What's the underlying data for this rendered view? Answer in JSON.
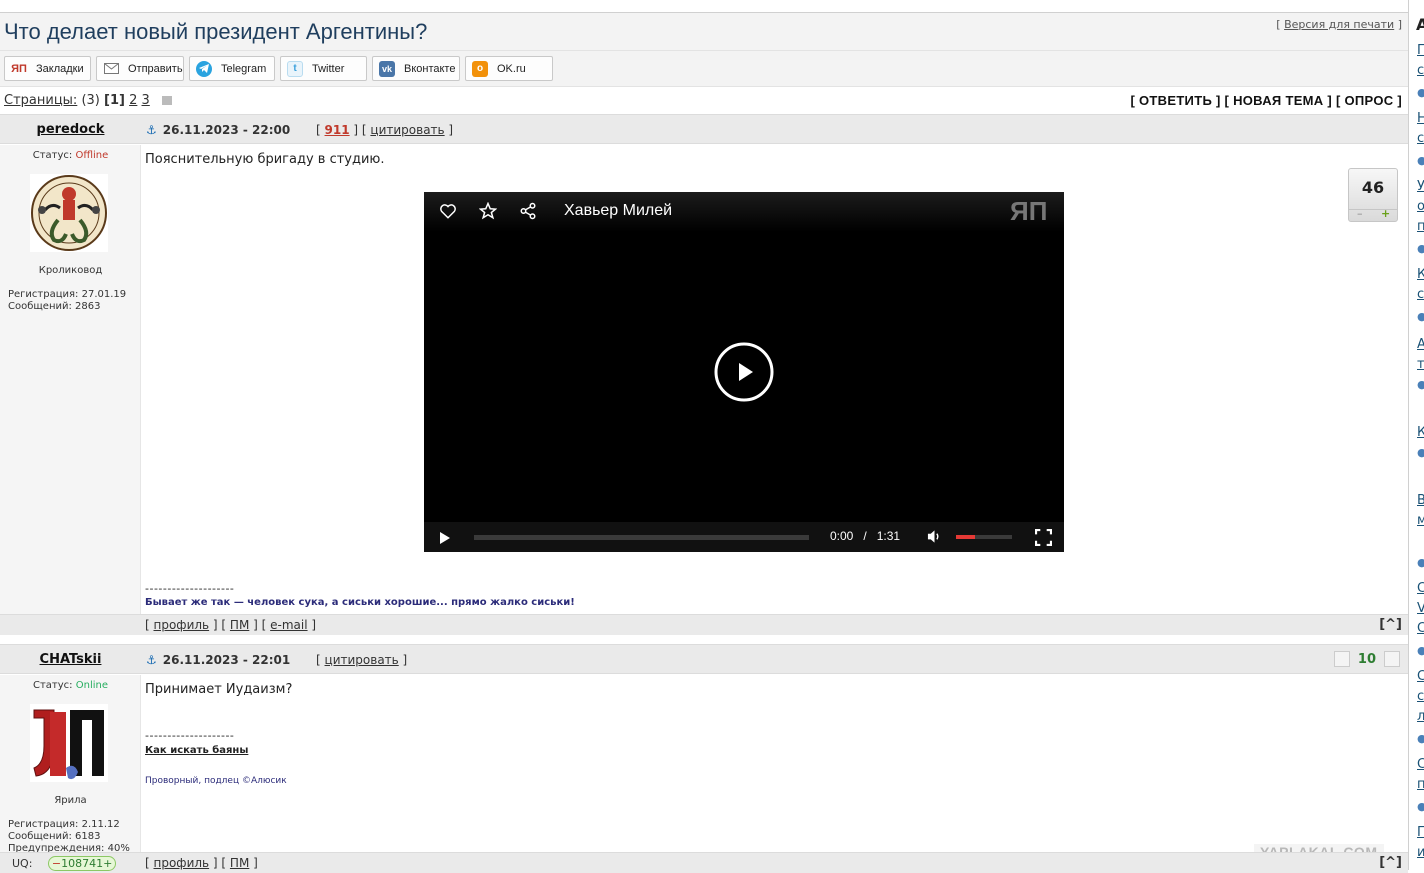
{
  "topic": {
    "title": "Что делает новый президент Аргентины?",
    "print_version": "Версия для печати"
  },
  "share_buttons": [
    {
      "label": "Закладки",
      "icon": "yp-bookmark-icon"
    },
    {
      "label": "Отправить",
      "icon": "mail-icon"
    },
    {
      "label": "Telegram",
      "icon": "telegram-icon"
    },
    {
      "label": "Twitter",
      "icon": "twitter-icon"
    },
    {
      "label": "Вконтакте",
      "icon": "vk-icon"
    },
    {
      "label": "OK.ru",
      "icon": "odnoklassniki-icon"
    }
  ],
  "pages": {
    "label": "Страницы:",
    "count": "(3)",
    "current": "[1]",
    "others": [
      "2",
      "3"
    ],
    "actions": "[ ОТВЕТИТЬ ] [ НОВАЯ ТЕМА ] [ ОПРОС ]"
  },
  "posts": [
    {
      "author": "peredock",
      "status_label": "Статус:",
      "status": "Offline",
      "rank": "Кроликовод",
      "registration": "Регистрация: 27.01.19",
      "messages": "Сообщений: 2863",
      "date": "26.11.2023 - 22:00",
      "post_number": "911",
      "quote": "цитировать",
      "text": "Пояснительную бригаду в студию.",
      "signature_sep": "--------------------",
      "signature": "Бывает же так — человек сука, а сиськи хорошие... прямо жалко сиськи!",
      "rating": "46",
      "video": {
        "title": "Хавьер Милей",
        "time_current": "0:00",
        "time_sep": "/",
        "time_total": "1:31",
        "logo": "ЯП"
      },
      "footer": [
        "профиль",
        "ПМ",
        "e-mail"
      ],
      "top_link": "[^]"
    },
    {
      "author": "CHATskii",
      "status_label": "Статус:",
      "status": "Online",
      "rank": "Ярила",
      "registration": "Регистрация: 2.11.12",
      "messages": "Сообщений: 6183",
      "warnings_label": "Предупреждения:",
      "warnings_value": "40",
      "date": "26.11.2023 - 22:01",
      "quote": "цитировать",
      "text": "Принимает Иудаизм?",
      "signature_sep": "--------------------",
      "signature_link": "Как искать баяны",
      "signature_note": "Проворный, подлец ©Алюсик",
      "rating": "10",
      "uq_label": "UQ:",
      "uq_value": "108741",
      "footer": [
        "профиль",
        "ПМ"
      ],
      "top_link": "[^]"
    }
  ],
  "watermark": "YAPLAKAL.COM",
  "colors": {
    "title": "#1f3e5e",
    "offline": "#c0392b",
    "online": "#27ae60",
    "signature": "#2c2c7a",
    "rating_green": "#2e7d32"
  }
}
